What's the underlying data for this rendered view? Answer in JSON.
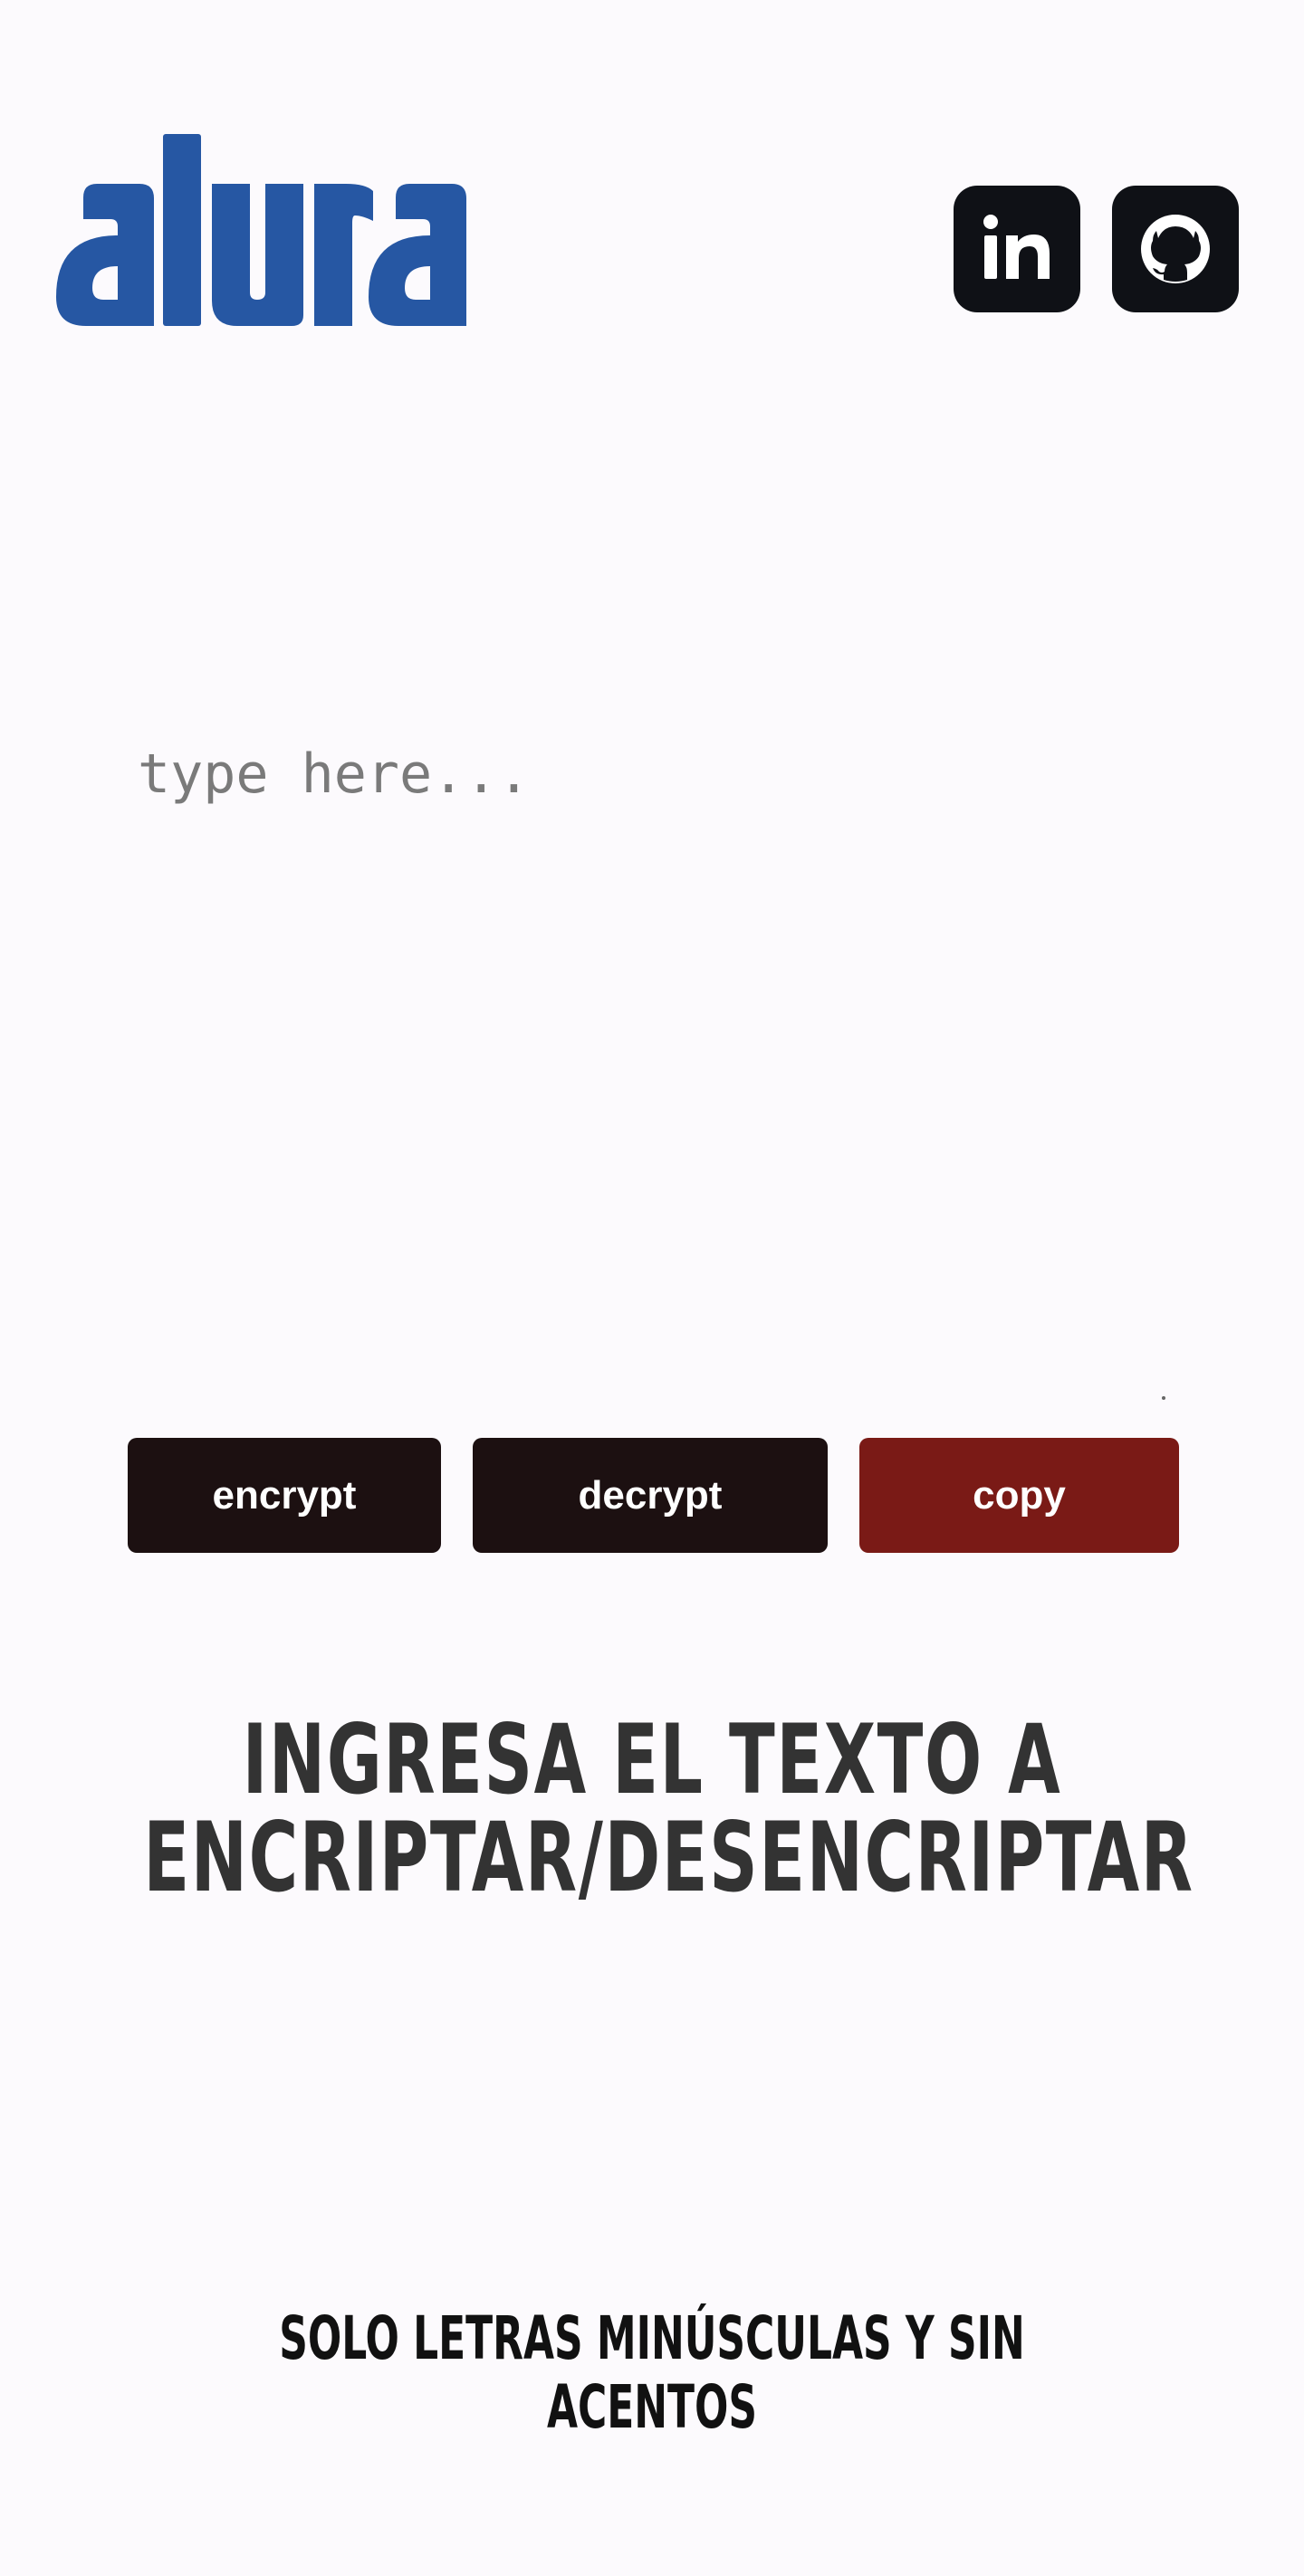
{
  "header": {
    "logo_text": "alura",
    "logo_color": "#2657A3",
    "social": [
      {
        "name": "linkedin",
        "icon": "linkedin-icon"
      },
      {
        "name": "github",
        "icon": "github-icon"
      }
    ]
  },
  "editor": {
    "placeholder": "type here...",
    "value": ""
  },
  "buttons": {
    "encrypt_label": "encrypt",
    "decrypt_label": "decrypt",
    "copy_label": "copy"
  },
  "messages": {
    "headline": "INGRESA EL TEXTO A ENCRIPTAR/DESENCRIPTAR",
    "subline": "SOLO LETRAS MINÚSCULAS Y SIN ACENTOS"
  },
  "colors": {
    "background": "#FCFAFD",
    "button_dark": "#1C1011",
    "button_copy": "#7A1A16",
    "social_bg": "#0F1116"
  }
}
